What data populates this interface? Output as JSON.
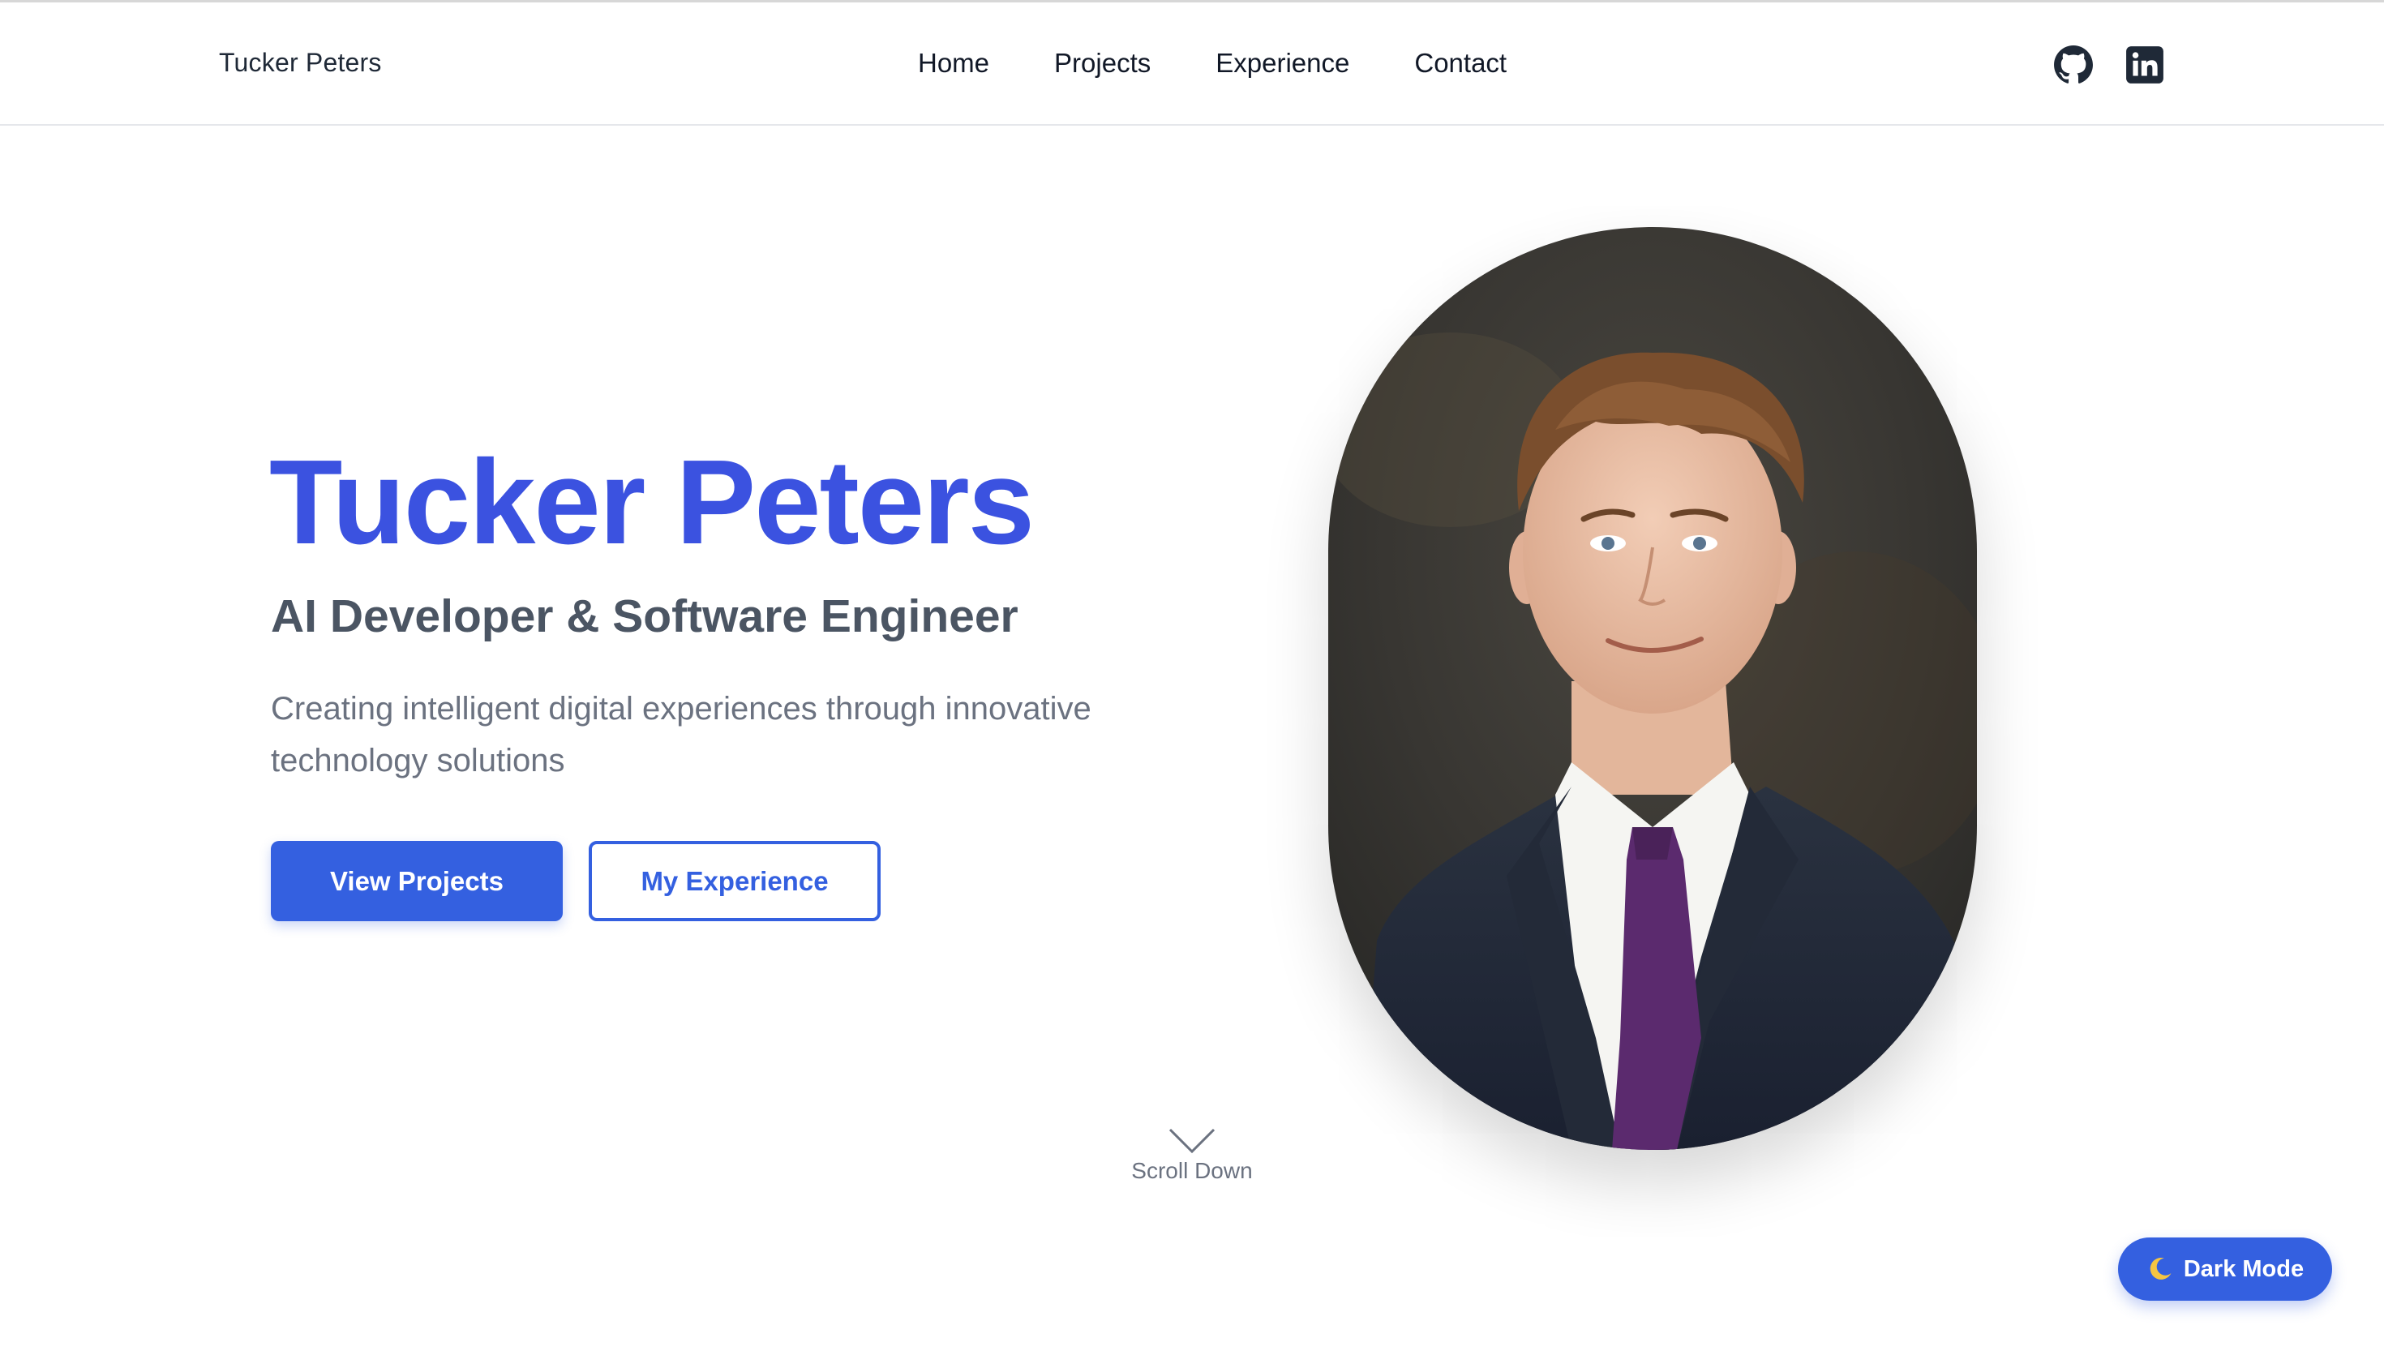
{
  "navbar": {
    "brand": "Tucker Peters",
    "links": [
      "Home",
      "Projects",
      "Experience",
      "Contact"
    ],
    "social": [
      "github-icon",
      "linkedin-icon"
    ]
  },
  "hero": {
    "title": "Tucker Peters",
    "subtitle": "AI Developer & Software Engineer",
    "description": "Creating intelligent digital experiences through innovative technology solutions",
    "primary_button": "View Projects",
    "secondary_button": "My Experience"
  },
  "scroll": {
    "label": "Scroll Down"
  },
  "theme_toggle": {
    "label": "Dark Mode",
    "icon": "moon-icon"
  },
  "colors": {
    "accent": "#3b52e0",
    "button": "#3460e0",
    "text_dark": "#111827",
    "text_muted": "#6b7280"
  }
}
